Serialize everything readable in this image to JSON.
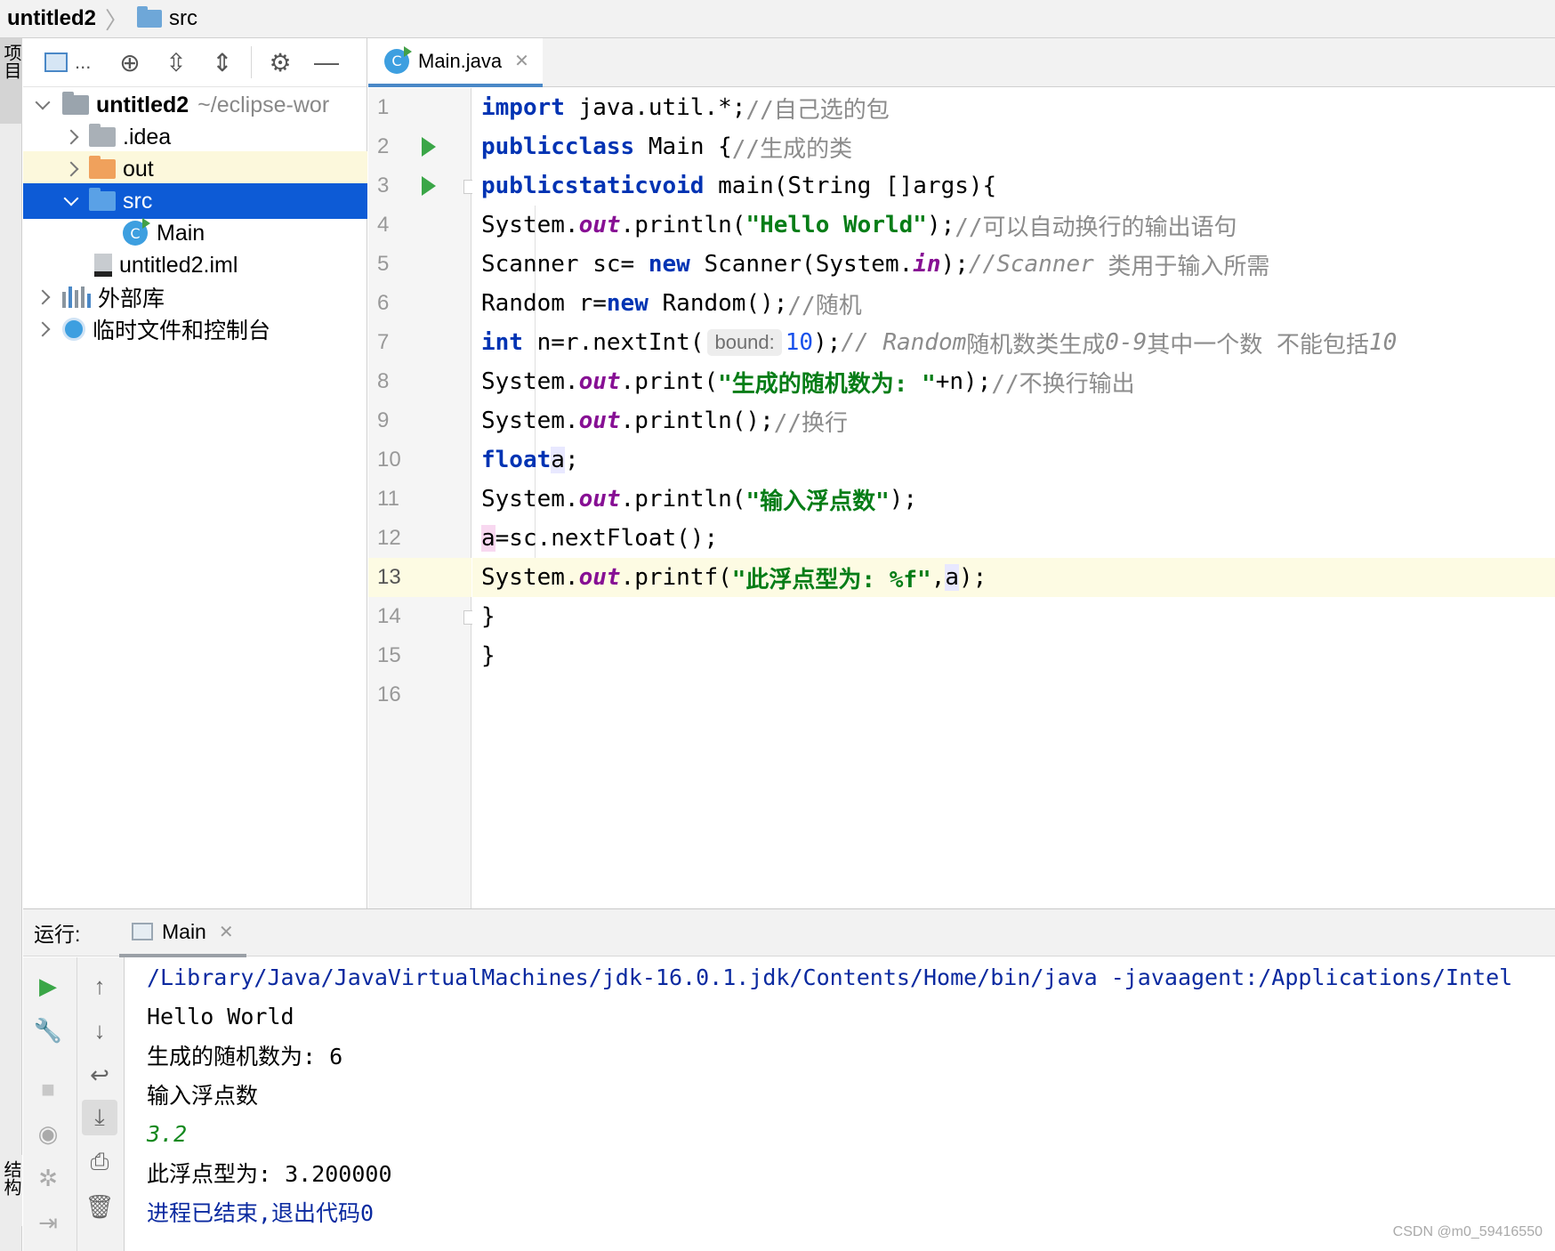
{
  "breadcrumb": {
    "project": "untitled2",
    "folder": "src"
  },
  "stripe": {
    "project_tab": "项目",
    "structure_tab": "结构"
  },
  "project_panel": {
    "toolbar_label": "...",
    "tree": [
      {
        "name": "untitled2",
        "path": "~/eclipse-wor",
        "level": 0,
        "expanded": true,
        "kind": "module"
      },
      {
        "name": ".idea",
        "level": 1,
        "expanded": false,
        "kind": "folder-gray"
      },
      {
        "name": "out",
        "level": 1,
        "expanded": false,
        "kind": "folder-orange",
        "highlighted": true
      },
      {
        "name": "src",
        "level": 1,
        "expanded": true,
        "kind": "folder-blue",
        "selected": true
      },
      {
        "name": "Main",
        "level": 2,
        "kind": "class"
      },
      {
        "name": "untitled2.iml",
        "level": 1,
        "kind": "file"
      },
      {
        "name": "外部库",
        "level": 0,
        "expanded": false,
        "kind": "library"
      },
      {
        "name": "临时文件和控制台",
        "level": 0,
        "expanded": false,
        "kind": "scratch"
      }
    ]
  },
  "editor": {
    "tab_label": "Main.java",
    "tab_icon_letter": "C",
    "current_line": 13,
    "line_numbers": [
      "1",
      "2",
      "3",
      "4",
      "5",
      "6",
      "7",
      "8",
      "9",
      "10",
      "11",
      "12",
      "13",
      "14",
      "15",
      "16"
    ],
    "lines": {
      "l1": {
        "kw": "import",
        "rest": " java.util.*;",
        "comment": "//自己选的包"
      },
      "l2": {
        "kw1": "public",
        "kw2": "class",
        "rest": " Main {",
        "comment": "//生成的类"
      },
      "l3": {
        "kw1": "public",
        "kw2": "static",
        "kw3": "void",
        "rest": " main(String []args){"
      },
      "l4": {
        "a": "System.",
        "field": "out",
        "b": ".println(",
        "str": "\"Hello World\"",
        "c": ");",
        "comment": "//可以自动换行的输出语句"
      },
      "l5": {
        "a": "Scanner sc= ",
        "kw": "new",
        "b": " Scanner(System.",
        "field": "in",
        "c": ");",
        "comment1": "//Scanner",
        "comment2": " 类用于输入所需"
      },
      "l6": {
        "a": "Random r=",
        "kw": "new",
        "b": " Random();",
        "comment": "//随机"
      },
      "l7": {
        "kw": "int",
        "a": " n=r.nextInt(",
        "hint": "bound:",
        "num": "10",
        "b": ");",
        "comment1": "// Random",
        "comment2": "随机数类生成",
        "comment3": "0-9",
        "comment4": "其中一个数 不能包括",
        "comment5": "10"
      },
      "l8": {
        "a": "System.",
        "field": "out",
        "b": ".print(",
        "str": "\"生成的随机数为: \"",
        "c": "+n);",
        "comment": "//不换行输出"
      },
      "l9": {
        "a": "System.",
        "field": "out",
        "b": ".println();",
        "comment": "//换行"
      },
      "l10": {
        "kw": "float",
        "var": "a",
        "b": ";"
      },
      "l11": {
        "a": "System.",
        "field": "out",
        "b": ".println(",
        "str": "\"输入浮点数\"",
        "c": ");"
      },
      "l12": {
        "var": "a",
        "b": "=sc.nextFloat();"
      },
      "l13": {
        "a": "System.",
        "field": "out",
        "b": ".printf(",
        "str": "\"此浮点型为: %f\"",
        "c": ",",
        "var": "a",
        "d": ");"
      },
      "l14": {
        "a": "}"
      },
      "l15": {
        "a": "}"
      }
    }
  },
  "run_panel": {
    "label": "运行:",
    "tab_label": "Main",
    "output": [
      {
        "text": "/Library/Java/JavaVirtualMachines/jdk-16.0.1.jdk/Contents/Home/bin/java -javaagent:/Applications/Intel",
        "color": "#0b2aa0"
      },
      {
        "text": "Hello World",
        "color": "#000000"
      },
      {
        "text": "生成的随机数为: 6",
        "color": "#000000"
      },
      {
        "text": "输入浮点数",
        "color": "#000000"
      },
      {
        "text": "3.2",
        "color": "#14891f"
      },
      {
        "text": "此浮点型为: 3.200000",
        "color": "#000000"
      },
      {
        "text": "进程已结束,退出代码0",
        "color": "#0b2aa0"
      }
    ]
  },
  "watermark": "CSDN @m0_59416550",
  "colors": {
    "selection": "#0d5bd6",
    "keyword": "#0033b3",
    "string": "#067d17",
    "field": "#871094",
    "comment": "#8c8c8c",
    "run_green": "#3aa647"
  }
}
